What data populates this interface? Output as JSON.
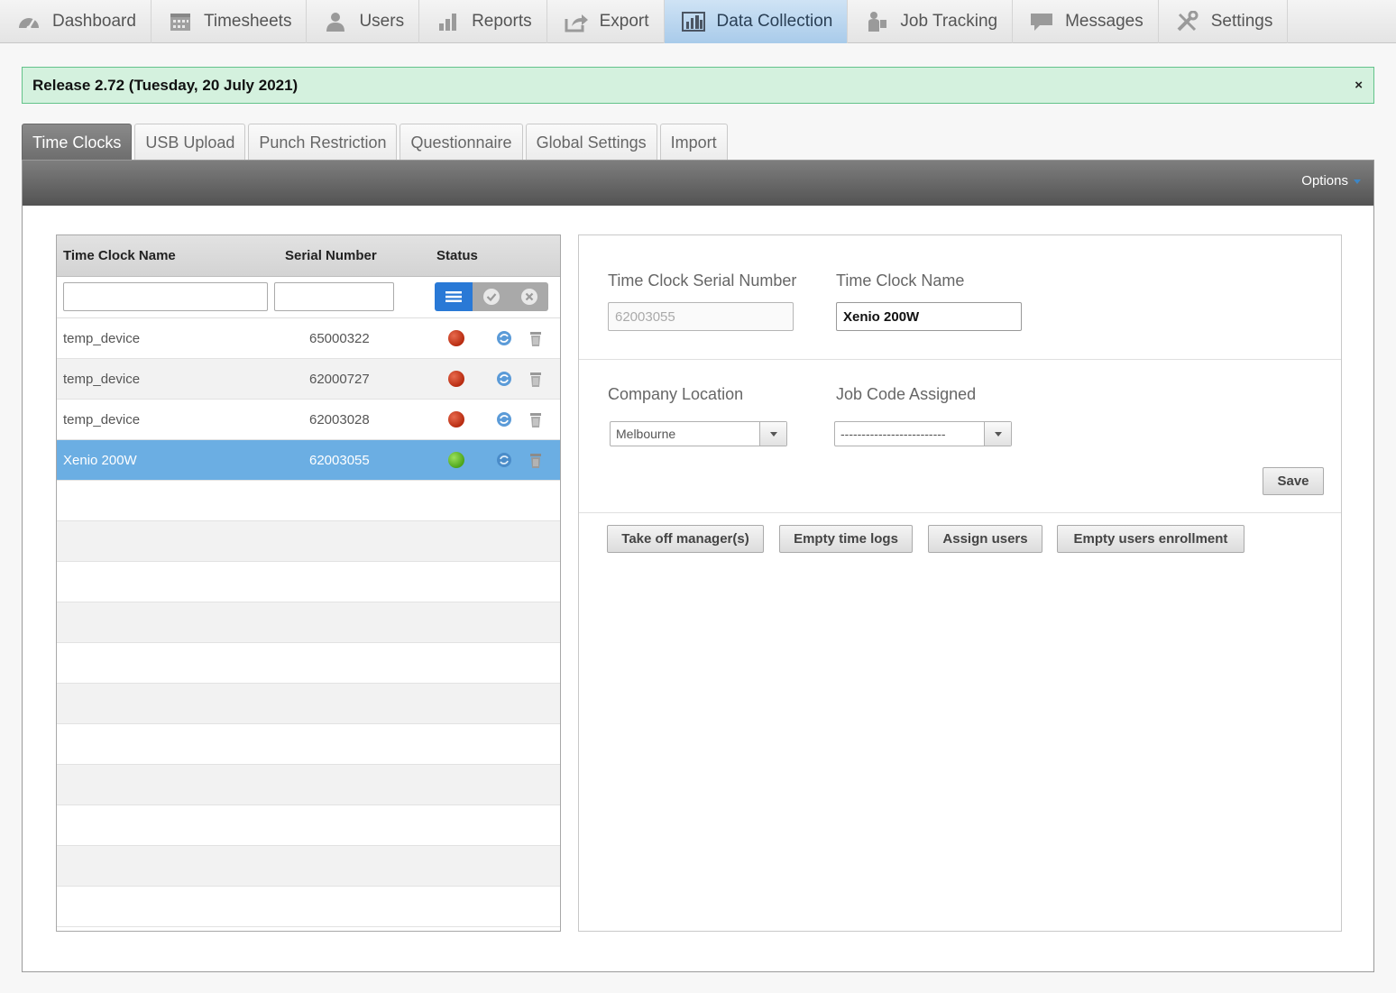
{
  "nav": {
    "items": [
      {
        "label": "Dashboard",
        "icon": "dashboard-gauge-icon"
      },
      {
        "label": "Timesheets",
        "icon": "calendar-icon"
      },
      {
        "label": "Users",
        "icon": "user-icon"
      },
      {
        "label": "Reports",
        "icon": "bar-chart-icon"
      },
      {
        "label": "Export",
        "icon": "export-icon"
      },
      {
        "label": "Data Collection",
        "icon": "data-collection-icon",
        "active": true
      },
      {
        "label": "Job Tracking",
        "icon": "job-tracking-icon"
      },
      {
        "label": "Messages",
        "icon": "speech-bubble-icon"
      },
      {
        "label": "Settings",
        "icon": "tools-icon"
      }
    ]
  },
  "banner": {
    "text": "Release 2.72 (Tuesday, 20 July 2021)",
    "close": "×",
    "bg": "#d4f1de"
  },
  "tabs": [
    "Time Clocks",
    "USB Upload",
    "Punch Restriction",
    "Questionnaire",
    "Global Settings",
    "Import"
  ],
  "toolbar": {
    "options_label": "Options"
  },
  "list": {
    "headers": {
      "name": "Time Clock Name",
      "serial": "Serial Number",
      "status": "Status"
    },
    "filter": {
      "name_value": "",
      "serial_value": ""
    },
    "rows": [
      {
        "name": "temp_device",
        "serial": "65000322",
        "status": "offline"
      },
      {
        "name": "temp_device",
        "serial": "62000727",
        "status": "offline"
      },
      {
        "name": "temp_device",
        "serial": "62003028",
        "status": "offline"
      },
      {
        "name": "Xenio 200W",
        "serial": "62003055",
        "status": "online",
        "selected": true
      }
    ],
    "empty_rows": 11
  },
  "form": {
    "serial_label": "Time Clock Serial Number",
    "serial_value": "62003055",
    "name_label": "Time Clock Name",
    "name_value": "Xenio 200W",
    "location_label": "Company Location",
    "location_value": "Melbourne",
    "job_label": "Job Code Assigned",
    "job_value": "-------------------------",
    "save_label": "Save",
    "actions": {
      "take_off": "Take off manager(s)",
      "empty_logs": "Empty time logs",
      "assign": "Assign users",
      "empty_enroll": "Empty users enrollment"
    }
  },
  "colors": {
    "accent": "#2979d6",
    "selected_row": "#6baee3",
    "online": "#4ca51c",
    "offline": "#b72b10"
  }
}
